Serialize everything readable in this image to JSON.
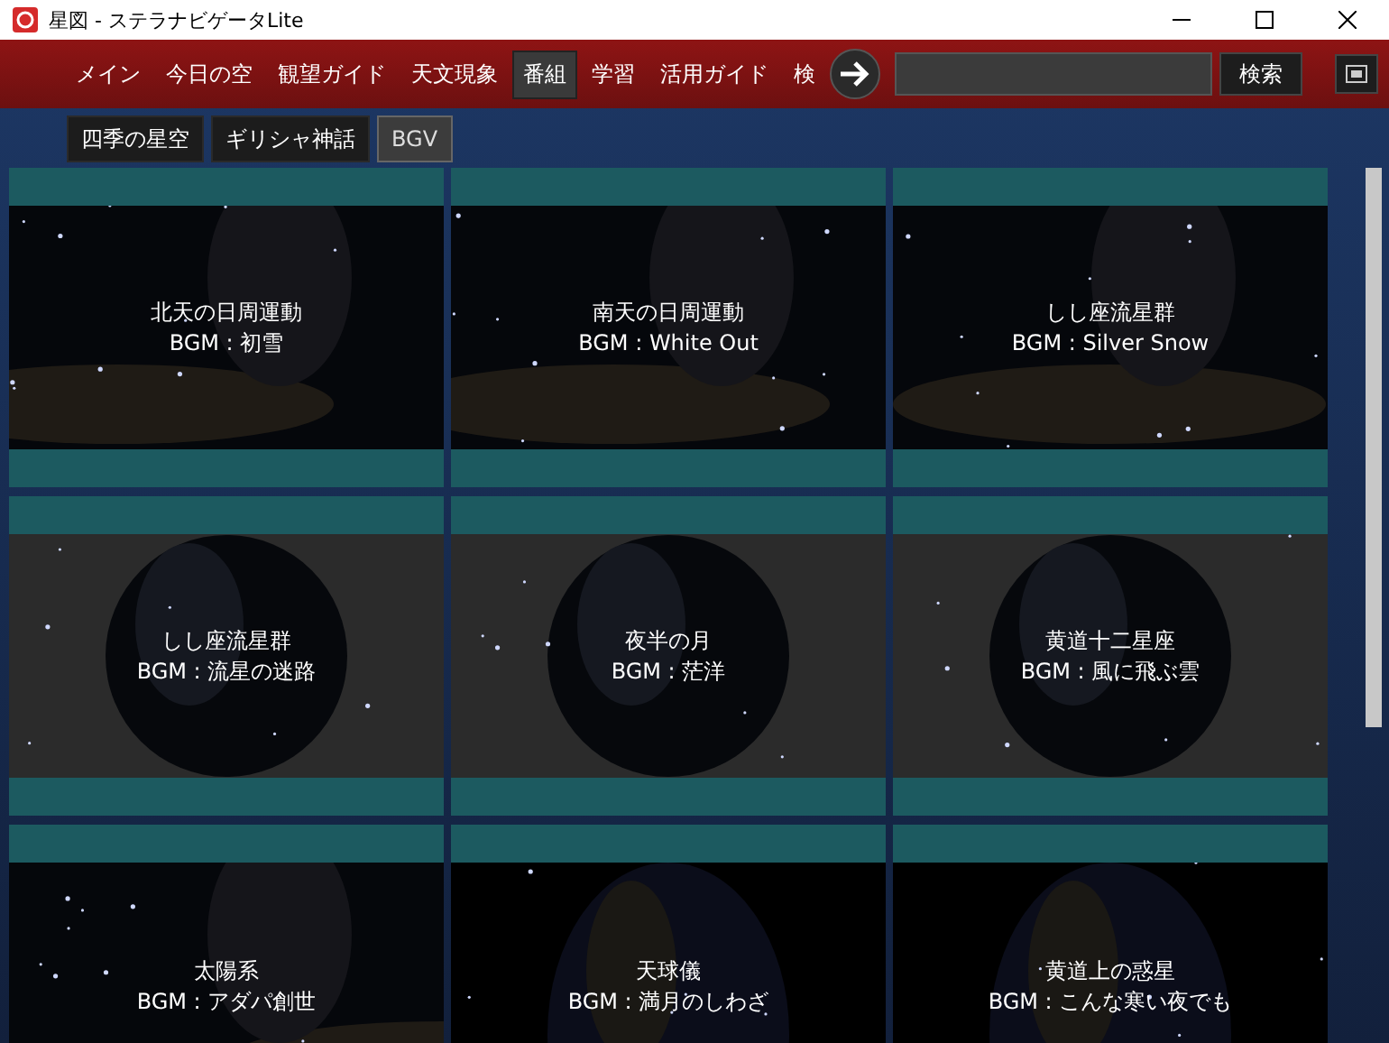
{
  "window": {
    "title": "星図 - ステラナビゲータLite"
  },
  "nav": {
    "items": [
      {
        "label": "メイン",
        "selected": false
      },
      {
        "label": "今日の空",
        "selected": false
      },
      {
        "label": "観望ガイド",
        "selected": false
      },
      {
        "label": "天文現象",
        "selected": false
      },
      {
        "label": "番組",
        "selected": true
      },
      {
        "label": "学習",
        "selected": false
      },
      {
        "label": "活用ガイド",
        "selected": false
      },
      {
        "label": "検",
        "selected": false
      }
    ],
    "search_button": "検索"
  },
  "subtabs": [
    {
      "label": "四季の星空",
      "selected": false
    },
    {
      "label": "ギリシャ神話",
      "selected": false
    },
    {
      "label": "BGV",
      "selected": true
    }
  ],
  "programs": [
    {
      "title": "北天の日周運動",
      "bgm": "BGM : 初雪",
      "kind": "panorama"
    },
    {
      "title": "南天の日周運動",
      "bgm": "BGM : White Out",
      "kind": "panorama"
    },
    {
      "title": "しし座流星群",
      "bgm": "BGM : Silver Snow",
      "kind": "panorama"
    },
    {
      "title": "しし座流星群",
      "bgm": "BGM : 流星の迷路",
      "kind": "dome"
    },
    {
      "title": "夜半の月",
      "bgm": "BGM : 茫洋",
      "kind": "dome"
    },
    {
      "title": "黄道十二星座",
      "bgm": "BGM : 風に飛ぶ雲",
      "kind": "dome"
    },
    {
      "title": "太陽系",
      "bgm": "BGM : アダパ創世",
      "kind": "panorama"
    },
    {
      "title": "天球儀",
      "bgm": "BGM : 満月のしわざ",
      "kind": "sphere"
    },
    {
      "title": "黄道上の惑星",
      "bgm": "BGM : こんな寒い夜でも",
      "kind": "sphere"
    }
  ]
}
